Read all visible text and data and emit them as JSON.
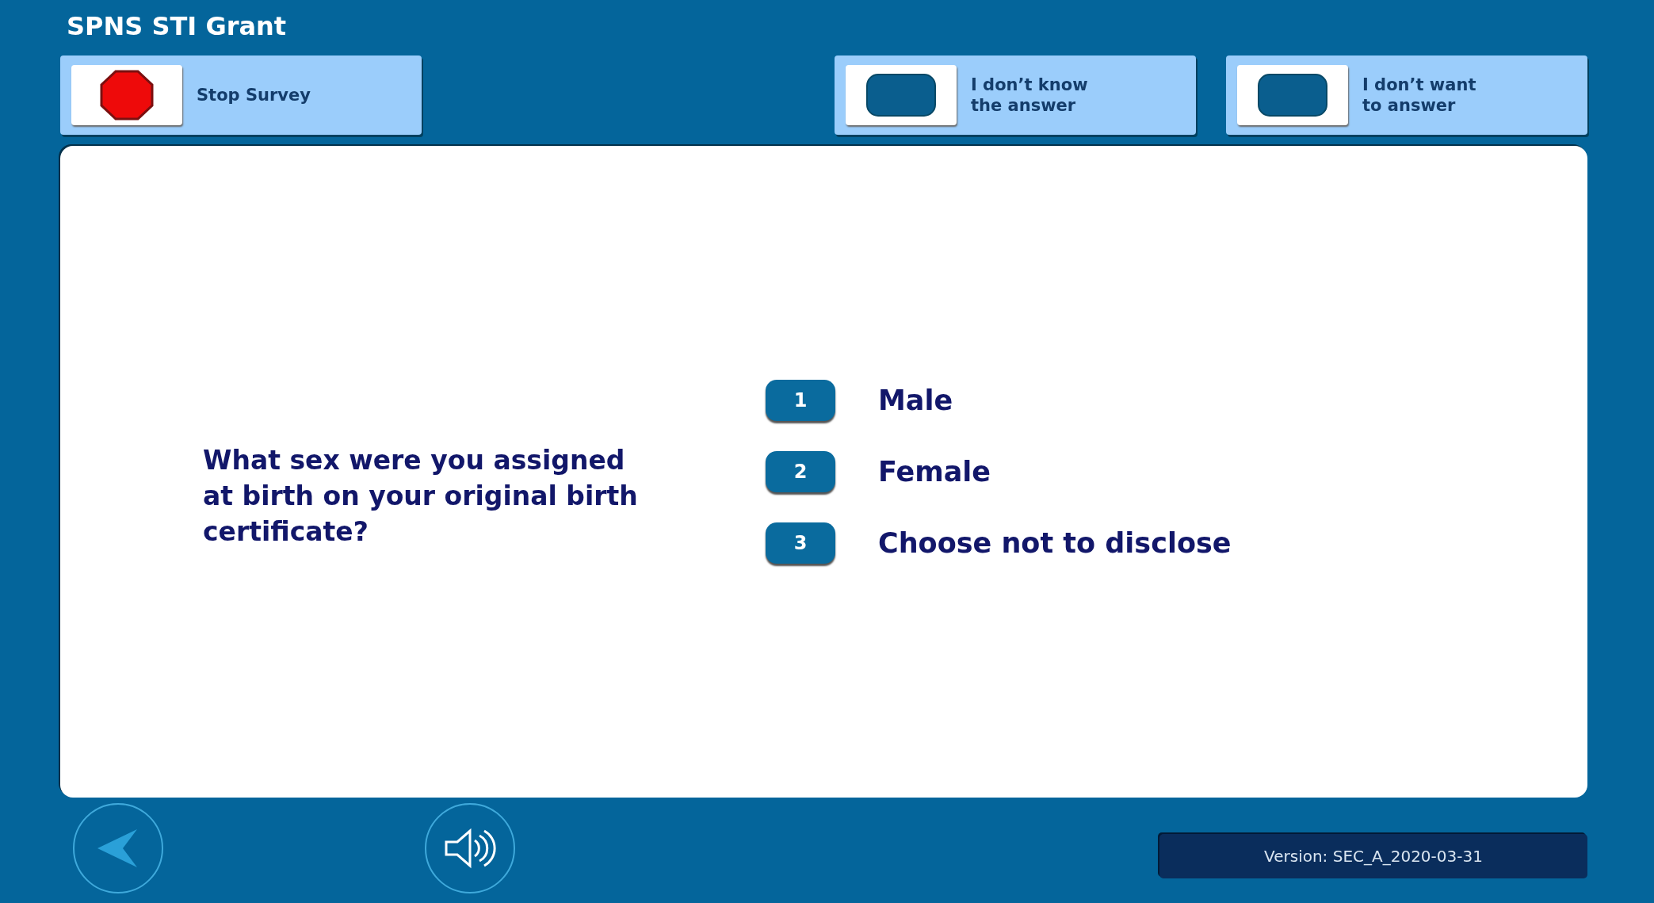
{
  "app_title": "SPNS STI Grant",
  "toolbar": [
    {
      "kind": "stop",
      "label": "Stop Survey"
    },
    {
      "kind": "key",
      "label": "I don’t know\nthe answer"
    },
    {
      "kind": "key",
      "label": "I don’t want\nto answer"
    }
  ],
  "question": "What sex were you assigned at birth on your original birth certificate?",
  "options": [
    {
      "number": "1",
      "label": "Male"
    },
    {
      "number": "2",
      "label": "Female"
    },
    {
      "number": "3",
      "label": "Choose not to disclose"
    }
  ],
  "version": "Version: SEC_A_2020-03-31"
}
